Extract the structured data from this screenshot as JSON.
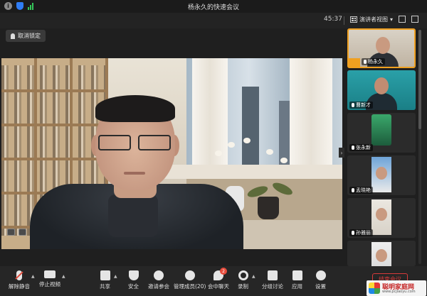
{
  "window": {
    "title": "杨永久的快速会议"
  },
  "topbar": {
    "timer": "45:37",
    "view_label": "演讲者视图"
  },
  "main": {
    "unlock_label": "取消锁定"
  },
  "participants": [
    {
      "name": "杨永久",
      "active": true
    },
    {
      "name": "曹新才"
    },
    {
      "name": "张永新"
    },
    {
      "name": "孟晓艳"
    },
    {
      "name": "孙雅丽"
    },
    {
      "name": ""
    }
  ],
  "toolbar": {
    "unmute": "解除静音",
    "stop_video": "停止视频",
    "share": "共享",
    "security": "安全",
    "invite": "邀请参会",
    "manage": "管理成员(20)",
    "chat": "会中聊天",
    "chat_badge": "2",
    "record": "录制",
    "breakout": "分组讨论",
    "apps": "应用",
    "settings": "设置",
    "end": "结束会议"
  },
  "watermark": {
    "brand": "聪明家庭网",
    "url": "www.pcjiaoyu.com"
  },
  "colors": {
    "accent": "#2f7df6",
    "active_border": "#f0a020",
    "danger": "#d93a3a"
  }
}
